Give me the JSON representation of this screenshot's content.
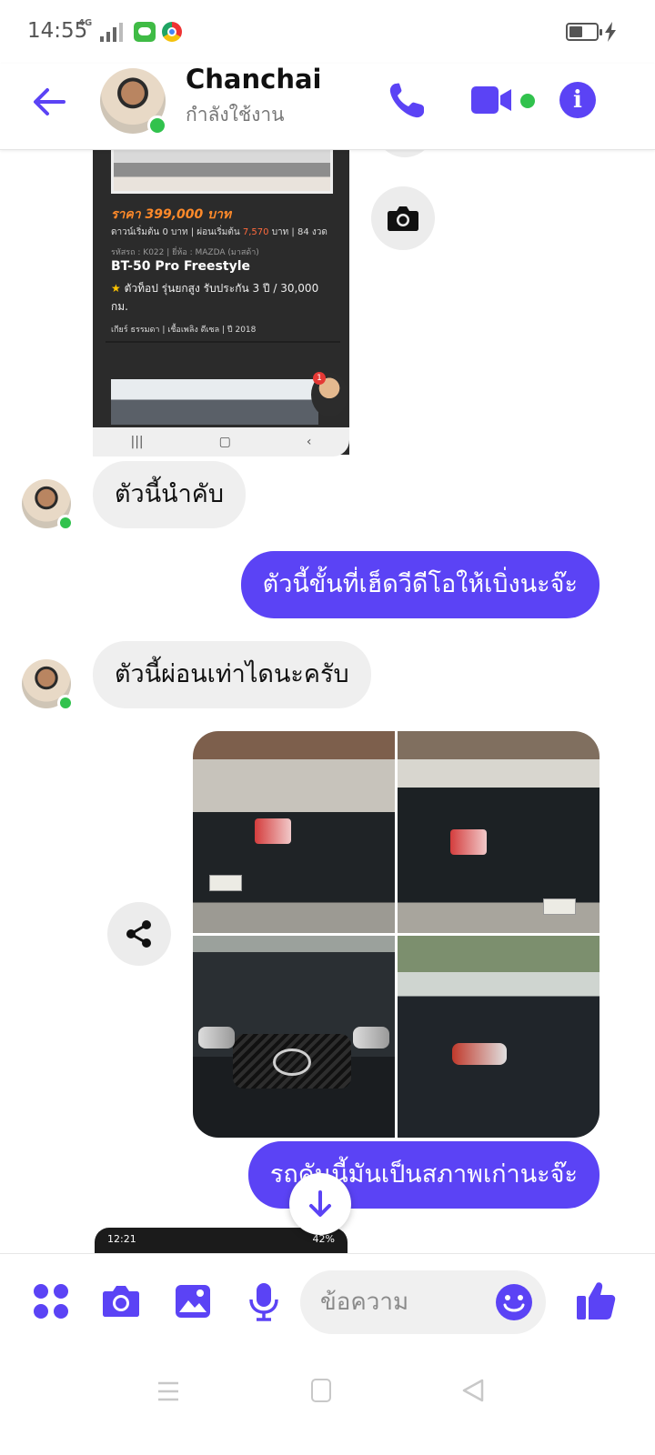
{
  "status_bar": {
    "time": "14:55",
    "network": "4G"
  },
  "header": {
    "contact_name": "Chanchai",
    "contact_status": "กำลังใช้งาน"
  },
  "shared_screenshot": {
    "price": "ราคา 399,000 บาท",
    "down_payment_prefix": "ดาวน์เริ่มต้น 0 บาท | ผ่อนเริ่มต้น",
    "installment": "7,570",
    "installment_suffix": "บาท | 84 งวด",
    "meta": "รหัสรถ : K022 | ยี่ห้อ : MAZDA (มาสด้า)",
    "model": "BT-50 Pro Freestyle",
    "warranty": "ตัวท็อป รุ่นยกสูง รับประกัน 3 ปี / 30,000 กม.",
    "specs": "เกียร์ ธรรมดา | เชื้อเพลิง ดีเซล | ปี 2018",
    "notification_count": "1",
    "nav_keys": [
      "|||",
      "▢",
      "‹"
    ]
  },
  "messages": [
    {
      "direction": "in",
      "text": "ตัวนี้นำคับ"
    },
    {
      "direction": "out",
      "text": "ตัวนี้ขั้นที่เฮ็ดวีดีโอให้เบิ่งนะจ๊ะ"
    },
    {
      "direction": "in",
      "text": "ตัวนี้ผ่อนเท่าไดนะครับ"
    },
    {
      "direction": "out",
      "text": "รถคันนี้มันเป็นสภาพเก่านะจ๊ะ"
    }
  ],
  "second_screenshot": {
    "time": "12:21",
    "battery": "42%"
  },
  "composer": {
    "placeholder": "ข้อความ"
  },
  "colors": {
    "accent": "#5b43f5",
    "online": "#31c24d",
    "incoming_bubble": "#efefef"
  }
}
